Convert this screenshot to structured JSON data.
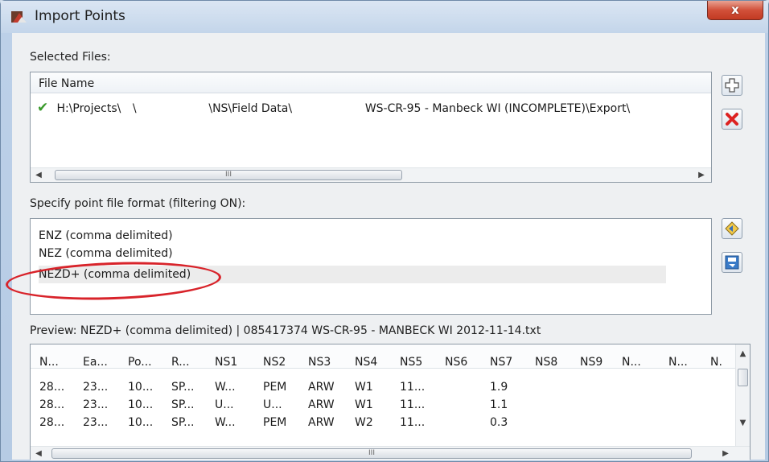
{
  "window": {
    "title": "Import Points",
    "close_label": "x"
  },
  "selected_files": {
    "label": "Selected Files:",
    "column_header": "File Name",
    "rows": [
      {
        "status": "valid",
        "path_part1": "H:\\Projects\\",
        "path_part2": "\\",
        "path_part3": "\\NS\\Field Data\\",
        "path_part4": "WS-CR-95 - Manbeck WI (INCOMPLETE)\\Export\\"
      }
    ],
    "scroll_thumb": "III"
  },
  "format": {
    "label": "Specify point file format (filtering ON):",
    "items": [
      {
        "label": "ENZ (comma delimited)",
        "selected": false
      },
      {
        "label": "NEZ (comma delimited)",
        "selected": false
      },
      {
        "label": "NEZD+ (comma delimited)",
        "selected": true
      }
    ],
    "highlight_color": "#d8232a"
  },
  "preview": {
    "label": "Preview: NEZD+ (comma delimited) | 085417374 WS-CR-95 - MANBECK WI 2012-11-14.txt",
    "columns": [
      "N...",
      "Ea...",
      "Po...",
      "R...",
      "NS1",
      "NS2",
      "NS3",
      "NS4",
      "NS5",
      "NS6",
      "NS7",
      "NS8",
      "NS9",
      "N...",
      "N...",
      "N."
    ],
    "rows": [
      [
        "28...",
        "23...",
        "10...",
        "SP...",
        "W...",
        "PEM",
        "ARW",
        "W1",
        "11...",
        "",
        "1.9"
      ],
      [
        "28...",
        "23...",
        "10...",
        "SP...",
        "U...",
        "U...",
        "ARW",
        "W1",
        "11...",
        "",
        "1.1"
      ],
      [
        "28...",
        "23...",
        "10...",
        "SP...",
        "W...",
        "PEM",
        "ARW",
        "W2",
        "11...",
        "",
        "0.3"
      ]
    ],
    "scroll_thumb": "III"
  },
  "icons": {
    "add_file": "add-file-icon",
    "remove_file": "remove-file-icon",
    "save_format": "format-settings-icon",
    "edit_format": "edit-format-icon"
  }
}
